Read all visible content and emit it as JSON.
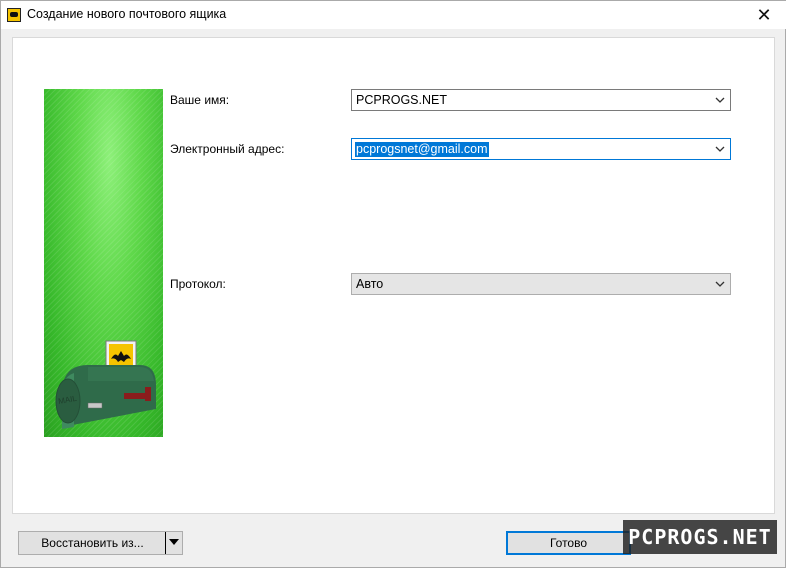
{
  "window": {
    "title": "Создание нового почтового ящика",
    "close_glyph": "✕"
  },
  "form": {
    "name_label": "Ваше имя:",
    "name_value": "PCPROGS.NET",
    "email_label": "Электронный адрес:",
    "email_value": "pcprogsnet@gmail.com",
    "protocol_label": "Протокол:",
    "protocol_value": "Авто"
  },
  "banner": {
    "icon": "mailbox-with-bat-stamp-icon",
    "mailbox_text": "MAIL"
  },
  "footer": {
    "restore_label": "Восстановить из...",
    "done_label": "Готово",
    "watermark": "PCPROGS.NET"
  },
  "colors": {
    "accent": "#0078d7",
    "banner_green": "#5fd84a",
    "mailbox_green": "#2f6b4a"
  }
}
